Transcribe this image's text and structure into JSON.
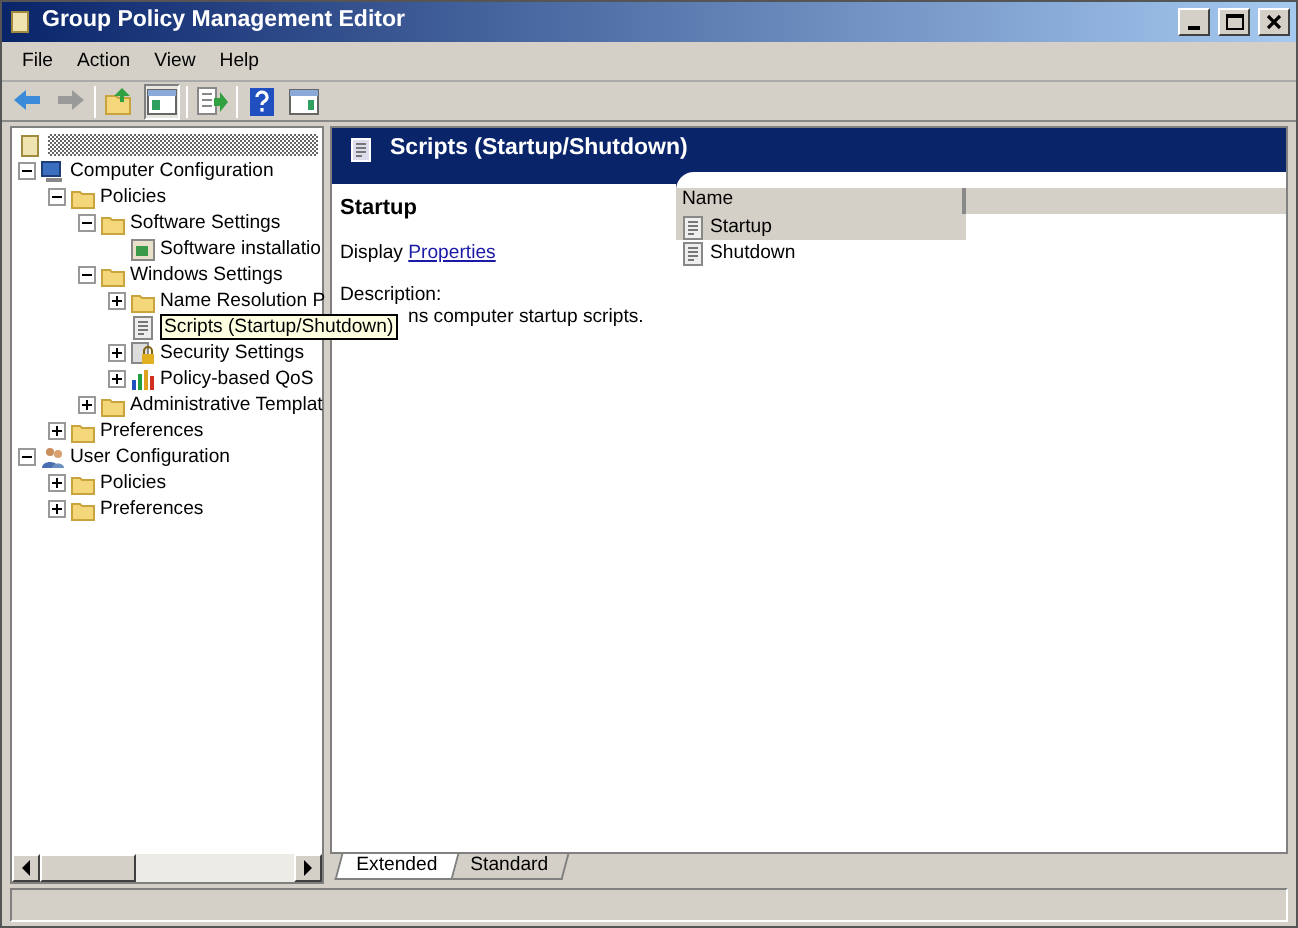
{
  "window": {
    "title": "Group Policy Management Editor"
  },
  "menu": [
    "File",
    "Action",
    "View",
    "Help"
  ],
  "toolbar": [
    {
      "kind": "back",
      "disabled": false,
      "pressed": false
    },
    {
      "kind": "forward",
      "disabled": true,
      "pressed": false
    },
    {
      "kind": "separator"
    },
    {
      "kind": "up",
      "disabled": false,
      "pressed": false
    },
    {
      "kind": "tree",
      "disabled": false,
      "pressed": true
    },
    {
      "kind": "separator"
    },
    {
      "kind": "export",
      "disabled": false,
      "pressed": false
    },
    {
      "kind": "separator"
    },
    {
      "kind": "help",
      "disabled": false,
      "pressed": false
    },
    {
      "kind": "pane",
      "disabled": false,
      "pressed": false
    }
  ],
  "tree": [
    {
      "kind": "computer",
      "label": "Computer Configuration",
      "expanded": true,
      "selected": false,
      "children": [
        {
          "kind": "folder",
          "label": "Policies",
          "expanded": true,
          "selected": false,
          "children": [
            {
              "kind": "folder",
              "label": "Software Settings",
              "expanded": true,
              "selected": false,
              "children": [
                {
                  "kind": "software",
                  "label": "Software installatio",
                  "selected": false
                }
              ]
            },
            {
              "kind": "folder",
              "label": "Windows Settings",
              "expanded": true,
              "selected": false,
              "children": [
                {
                  "kind": "folder",
                  "label": "Name Resolution P",
                  "expanded": false,
                  "selected": false
                },
                {
                  "kind": "script",
                  "label": "Scripts (Startup/Shutdown)",
                  "selected": true
                },
                {
                  "kind": "security",
                  "label": "Security Settings",
                  "expanded": false,
                  "selected": false
                },
                {
                  "kind": "chart",
                  "label": "Policy-based QoS",
                  "expanded": false,
                  "selected": false
                }
              ]
            },
            {
              "kind": "folder",
              "label": "Administrative Templat",
              "expanded": false,
              "selected": false
            }
          ]
        },
        {
          "kind": "folder",
          "label": "Preferences",
          "expanded": false,
          "selected": false
        }
      ]
    },
    {
      "kind": "user",
      "label": "User Configuration",
      "expanded": true,
      "selected": false,
      "children": [
        {
          "kind": "folder",
          "label": "Policies",
          "expanded": false,
          "selected": false
        },
        {
          "kind": "folder",
          "label": "Preferences",
          "expanded": false,
          "selected": false
        }
      ]
    }
  ],
  "details": {
    "title": "Scripts (Startup/Shutdown)",
    "heading": "Startup",
    "display_label": "Display",
    "display_link": "Properties",
    "description_label": "Description:",
    "description": "ns computer startup scripts.",
    "columns": [
      "Name"
    ],
    "items": [
      {
        "label": "Startup",
        "selected": true
      },
      {
        "label": "Shutdown",
        "selected": false
      }
    ],
    "tabs": [
      {
        "label": "Extended",
        "selected": true
      },
      {
        "label": "Standard",
        "selected": false
      }
    ]
  }
}
